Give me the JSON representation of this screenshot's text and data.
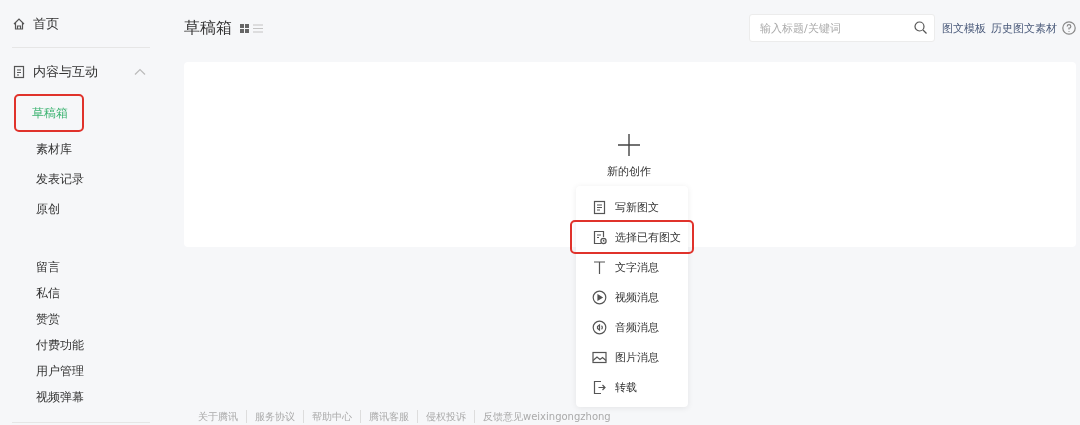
{
  "sidebar": {
    "home": {
      "label": "首页"
    },
    "group": {
      "label": "内容与互动",
      "expanded": true,
      "children": [
        {
          "label": "草稿箱",
          "selected": true,
          "highlighted": true
        },
        {
          "label": "素材库",
          "selected": false,
          "highlighted": false
        },
        {
          "label": "发表记录",
          "selected": false,
          "highlighted": false
        },
        {
          "label": "原创",
          "selected": false,
          "highlighted": false
        }
      ]
    },
    "items": [
      {
        "label": "留言",
        "selected": false
      },
      {
        "label": "私信",
        "selected": false
      },
      {
        "label": "赞赏",
        "selected": false
      },
      {
        "label": "付费功能",
        "selected": false
      },
      {
        "label": "用户管理",
        "selected": false
      },
      {
        "label": "视频弹幕",
        "selected": false
      }
    ]
  },
  "header": {
    "title": "草稿箱",
    "views": [
      {
        "kind": "grid",
        "selected": true
      },
      {
        "kind": "list",
        "selected": false
      }
    ],
    "search": {
      "placeholder": "输入标题/关键词"
    },
    "links": [
      "图文模板",
      "历史图文素材"
    ]
  },
  "create": {
    "label": "新的创作"
  },
  "menu": [
    {
      "kind": "article",
      "label": "写新图文",
      "highlighted": false
    },
    {
      "kind": "existing",
      "label": "选择已有图文",
      "highlighted": true
    },
    {
      "kind": "text",
      "label": "文字消息",
      "highlighted": false
    },
    {
      "kind": "video",
      "label": "视频消息",
      "highlighted": false
    },
    {
      "kind": "audio",
      "label": "音频消息",
      "highlighted": false
    },
    {
      "kind": "image",
      "label": "图片消息",
      "highlighted": false
    },
    {
      "kind": "repost",
      "label": "转载",
      "highlighted": false
    }
  ],
  "footer": [
    "关于腾讯",
    "服务协议",
    "帮助中心",
    "腾讯客服",
    "侵权投诉",
    "反馈意见weixingongzhong"
  ]
}
